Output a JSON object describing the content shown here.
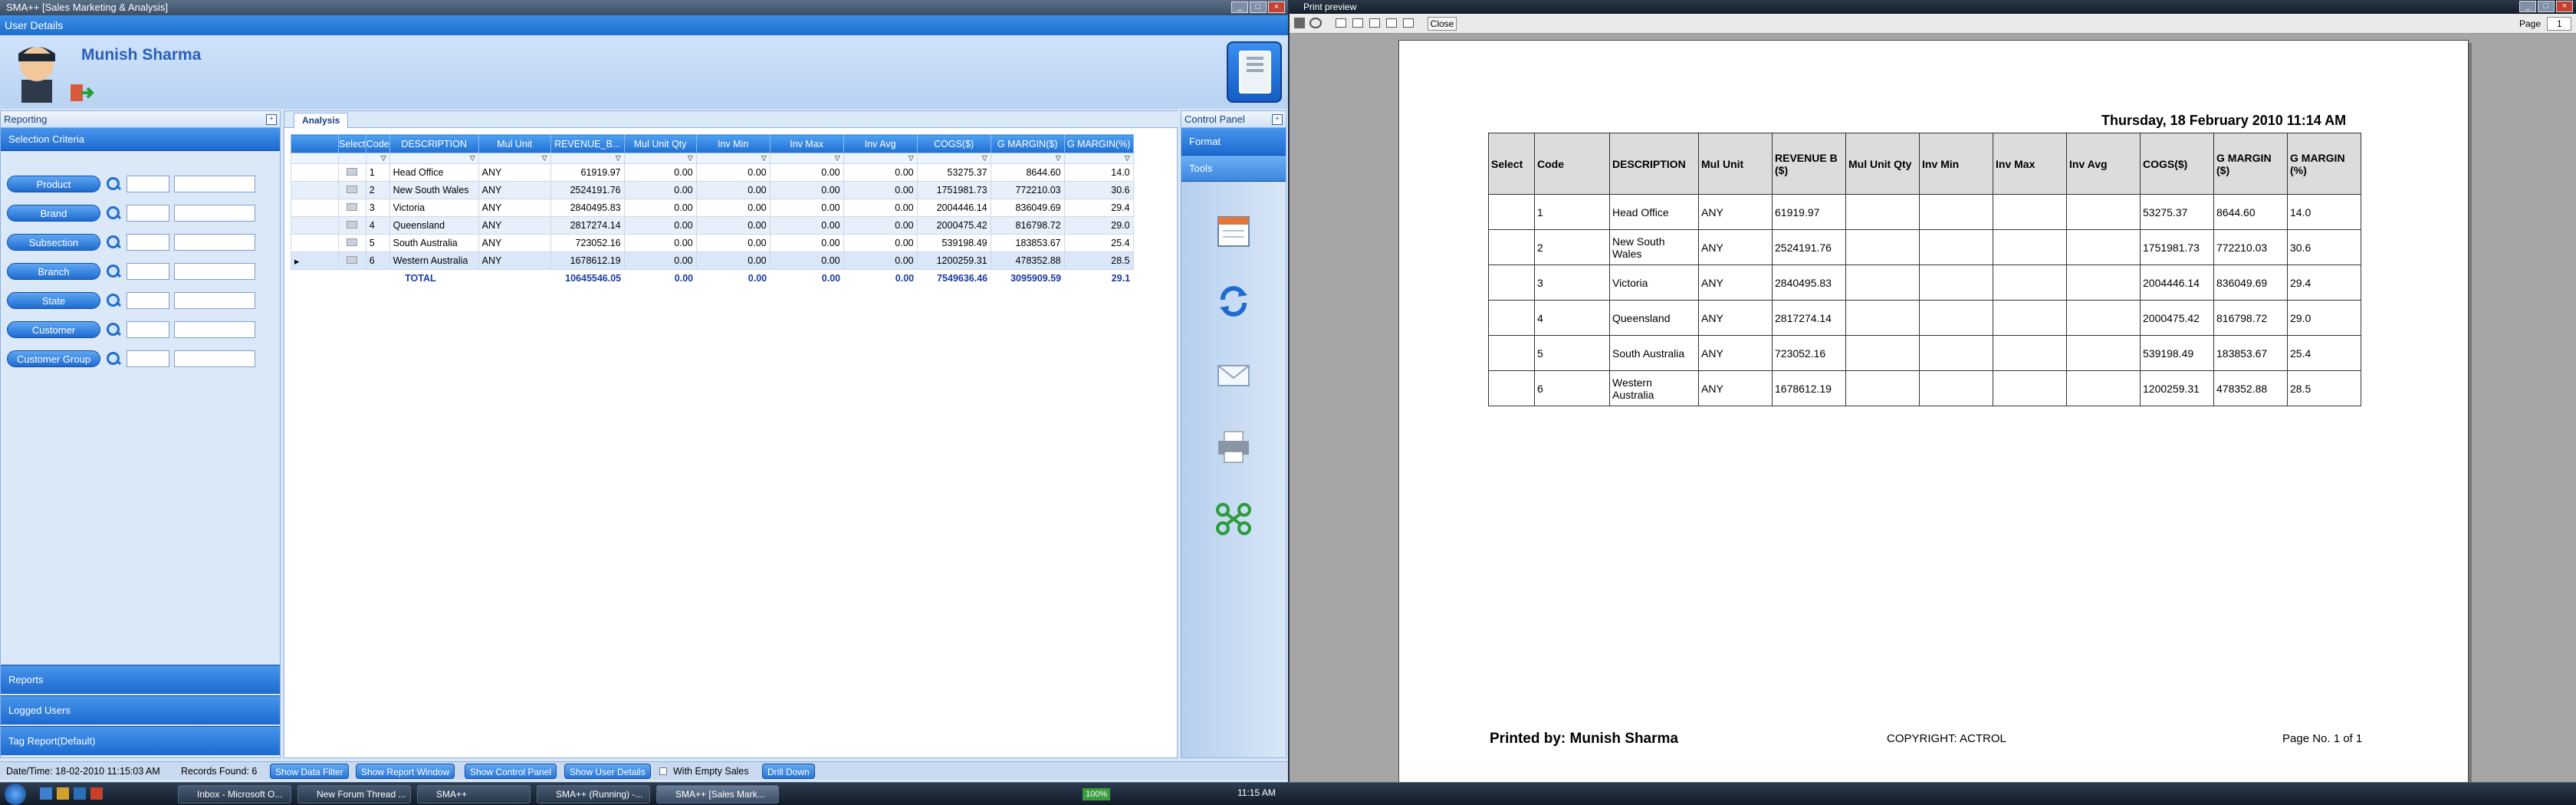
{
  "left_window": {
    "title": "SMA++ [Sales Marketing & Analysis]",
    "user_details_label": "User Details",
    "user_name": "Munish Sharma",
    "reporting_panel": {
      "title": "Reporting",
      "selection_criteria_label": "Selection Criteria",
      "criteria": [
        "Product",
        "Brand",
        "Subsection",
        "Branch",
        "State",
        "Customer",
        "Customer Group"
      ],
      "bottom_sections": [
        "Reports",
        "Logged Users",
        "Tag Report(Default)"
      ]
    },
    "analysis_tab": "Analysis",
    "grid": {
      "columns": [
        "Select",
        "Code",
        "DESCRIPTION",
        "Mul Unit",
        "REVENUE_B...",
        "Mul Unit Qty",
        "Inv Min",
        "Inv Max",
        "Inv Avg",
        "COGS($)",
        "G MARGIN($)",
        "G MARGIN(%)"
      ],
      "rows": [
        [
          "",
          "1",
          "Head Office",
          "ANY",
          "61919.97",
          "0.00",
          "0.00",
          "0.00",
          "0.00",
          "53275.37",
          "8644.60",
          "14.0"
        ],
        [
          "",
          "2",
          "New South Wales",
          "ANY",
          "2524191.76",
          "0.00",
          "0.00",
          "0.00",
          "0.00",
          "1751981.73",
          "772210.03",
          "30.6"
        ],
        [
          "",
          "3",
          "Victoria",
          "ANY",
          "2840495.83",
          "0.00",
          "0.00",
          "0.00",
          "0.00",
          "2004446.14",
          "836049.69",
          "29.4"
        ],
        [
          "",
          "4",
          "Queensland",
          "ANY",
          "2817274.14",
          "0.00",
          "0.00",
          "0.00",
          "0.00",
          "2000475.42",
          "816798.72",
          "29.0"
        ],
        [
          "",
          "5",
          "South Australia",
          "ANY",
          "723052.16",
          "0.00",
          "0.00",
          "0.00",
          "0.00",
          "539198.49",
          "183853.67",
          "25.4"
        ],
        [
          "",
          "6",
          "Western Australia",
          "ANY",
          "1678612.19",
          "0.00",
          "0.00",
          "0.00",
          "0.00",
          "1200259.31",
          "478352.88",
          "28.5"
        ]
      ],
      "total": {
        "label": "TOTAL",
        "revenue": "10645546.05",
        "mul_qty": "0.00",
        "inv_min": "0.00",
        "inv_max": "0.00",
        "inv_avg": "0.00",
        "cogs": "7549636.46",
        "gm": "3095909.59",
        "gmp": "29.1"
      }
    },
    "control_panel": {
      "title": "Control Panel",
      "format_label": "Format",
      "tools_label": "Tools",
      "icons": [
        "calendar-icon",
        "refresh-icon",
        "email-icon",
        "printer-icon",
        "link-icon"
      ]
    },
    "status": {
      "datetime": "Date/Time: 18-02-2010 11:15:03 AM",
      "records": "Records Found: 6",
      "buttons": [
        "Show Data Filter",
        "Show Report Window",
        "Show Control Panel",
        "Show User Details"
      ],
      "with_empty_sales": "With Empty Sales",
      "drill_down": "Drill Down"
    }
  },
  "right_window": {
    "title": "Print preview",
    "close_label": "Close",
    "page_label": "Page",
    "page_value": "1",
    "report_date": "Thursday, 18 February 2010 11:14 AM",
    "columns": [
      "Select",
      "Code",
      "DESCRIPTION",
      "Mul Unit",
      "REVENUE B ($)",
      "Mul Unit Qty",
      "Inv Min",
      "Inv Max",
      "Inv Avg",
      "COGS($)",
      "G MARGIN ($)",
      "G MARGIN (%)"
    ],
    "rows": [
      [
        "",
        "1",
        "Head Office",
        "ANY",
        "61919.97",
        "",
        "",
        "",
        "",
        "53275.37",
        "8644.60",
        "14.0"
      ],
      [
        "",
        "2",
        "New South Wales",
        "ANY",
        "2524191.76",
        "",
        "",
        "",
        "",
        "1751981.73",
        "772210.03",
        "30.6"
      ],
      [
        "",
        "3",
        "Victoria",
        "ANY",
        "2840495.83",
        "",
        "",
        "",
        "",
        "2004446.14",
        "836049.69",
        "29.4"
      ],
      [
        "",
        "4",
        "Queensland",
        "ANY",
        "2817274.14",
        "",
        "",
        "",
        "",
        "2000475.42",
        "816798.72",
        "29.0"
      ],
      [
        "",
        "5",
        "South Australia",
        "ANY",
        "723052.16",
        "",
        "",
        "",
        "",
        "539198.49",
        "183853.67",
        "25.4"
      ],
      [
        "",
        "6",
        "Western Australia",
        "ANY",
        "1678612.19",
        "",
        "",
        "",
        "",
        "1200259.31",
        "478352.88",
        "28.5"
      ]
    ],
    "printed_by": "Printed by: Munish Sharma",
    "copyright": "COPYRIGHT: ACTROL",
    "page_no": "Page No. 1 of 1"
  },
  "taskbar": {
    "items": [
      "Inbox - Microsoft O...",
      "New Forum Thread ...",
      "SMA++",
      "SMA++ (Running) -...",
      "SMA++ [Sales Mark..."
    ],
    "zoom": "100%",
    "clock": "11:15 AM"
  }
}
